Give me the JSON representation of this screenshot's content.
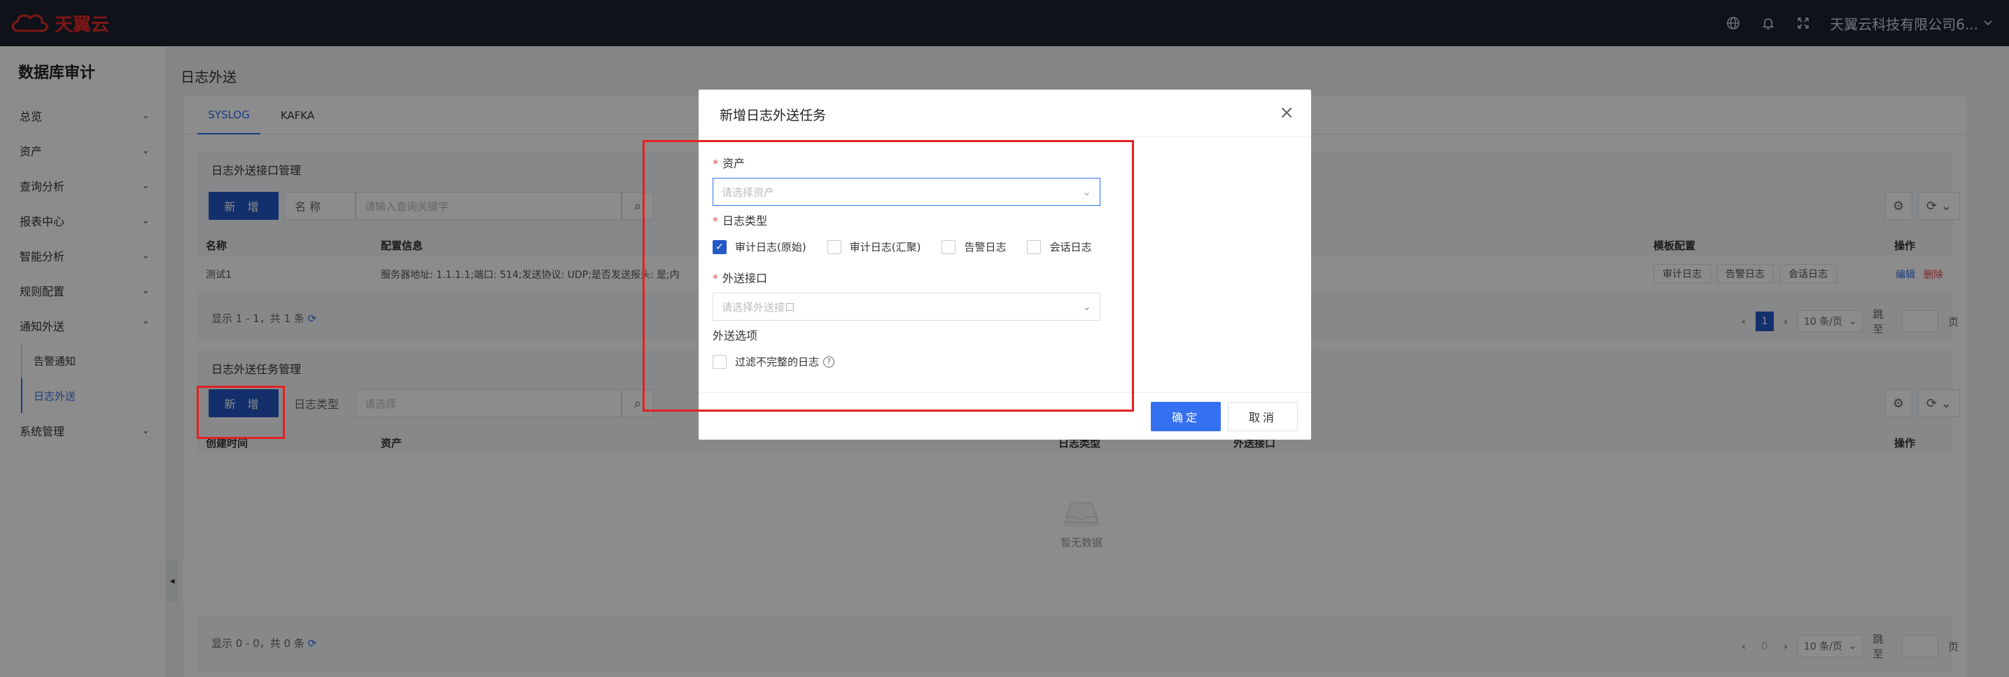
{
  "topbar": {
    "logo_text": "天翼云",
    "account_name": "天翼云科技有限公司6...",
    "brand_color": "#e42a2a"
  },
  "sidebar": {
    "title": "数据库审计",
    "items": [
      {
        "label": "总览"
      },
      {
        "label": "资产"
      },
      {
        "label": "查询分析"
      },
      {
        "label": "报表中心"
      },
      {
        "label": "智能分析"
      },
      {
        "label": "规则配置"
      },
      {
        "label": "通知外送"
      },
      {
        "label": "系统管理"
      }
    ],
    "sub_items": [
      {
        "label": "告警通知"
      },
      {
        "label": "日志外送"
      }
    ]
  },
  "page": {
    "title": "日志外送",
    "tabs": [
      {
        "label": "SYSLOG"
      },
      {
        "label": "KAFKA"
      }
    ]
  },
  "interface_section": {
    "title": "日志外送接口管理",
    "add_label": "新 增",
    "filter_label": "名 称",
    "filter_placeholder": "请输入查询关键字",
    "columns": [
      "名称",
      "配置信息",
      "模板配置",
      "操作"
    ],
    "rows": [
      {
        "name": "测试1",
        "config": "服务器地址: 1.1.1.1;端口: 514;发送协议: UDP;是否发送报头: 是;内",
        "templates": [
          "审计日志",
          "告警日志",
          "会话日志"
        ],
        "edit": "编辑",
        "delete": "删除"
      }
    ],
    "pager_info": "显示 1 - 1，共 1 条",
    "page_num": "1",
    "page_size": "10 条/页",
    "jump_label": "跳至",
    "page_suffix": "页"
  },
  "task_section": {
    "title": "日志外送任务管理",
    "add_label": "新 增",
    "filter_label": "日志类型",
    "filter_placeholder": "请选择",
    "columns": [
      "创建时间",
      "资产",
      "日志类型",
      "外送接口",
      "操作"
    ],
    "empty_text": "暂无数据",
    "pager_info": "显示 0 - 0，共 0 条",
    "page_num": "0",
    "page_size": "10 条/页",
    "jump_label": "跳至",
    "page_suffix": "页"
  },
  "modal": {
    "title": "新增日志外送任务",
    "asset_label": "资产",
    "asset_placeholder": "请选择资产",
    "log_type_label": "日志类型",
    "log_types": [
      {
        "label": "审计日志(原始)",
        "checked": true
      },
      {
        "label": "审计日志(汇聚)",
        "checked": false
      },
      {
        "label": "告警日志",
        "checked": false
      },
      {
        "label": "会话日志",
        "checked": false
      }
    ],
    "interface_label": "外送接口",
    "interface_placeholder": "请选择外送接口",
    "options_label": "外送选项",
    "filter_incomplete_label": "过滤不完整的日志",
    "ok_label": "确定",
    "cancel_label": "取消"
  },
  "colors": {
    "primary": "#2458c5",
    "highlight_red": "#e52020"
  }
}
